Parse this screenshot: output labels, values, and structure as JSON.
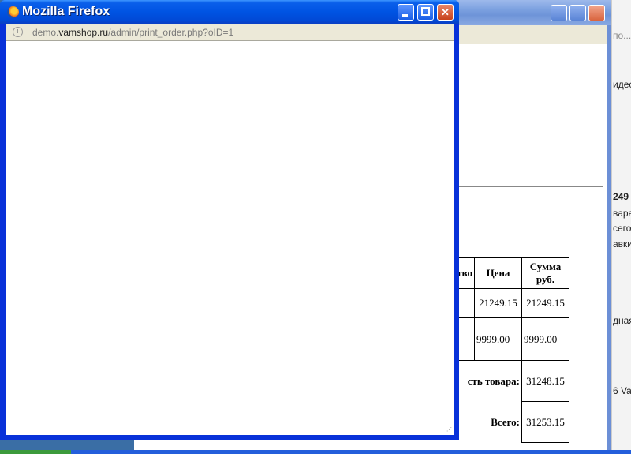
{
  "background_window": {
    "address_fragment": "по...",
    "video_fragment": "идес",
    "right_texts": [
      "249",
      "вара",
      "сего",
      "авки",
      "дная",
      "6 Var"
    ],
    "table": {
      "headers": [
        "тво",
        "Цена",
        "Сумма руб."
      ],
      "rows": [
        {
          "qty": "",
          "price": "21249.15",
          "sum": "21249.15"
        },
        {
          "qty": "",
          "price": "9999.00",
          "sum": "9999.00"
        }
      ],
      "subtotal_label": "сть товара:",
      "subtotal_value": "31248.15",
      "total_label": "Всего:",
      "total_value": "31253.15"
    }
  },
  "popup": {
    "title": "Mozilla Firefox",
    "url_prefix": "demo.",
    "url_host": "vamshop.ru",
    "url_path": "/admin/print_order.php?oID=1",
    "info_glyph": "i",
    "min_glyph": "",
    "max_glyph": "",
    "close_glyph": "✕"
  }
}
